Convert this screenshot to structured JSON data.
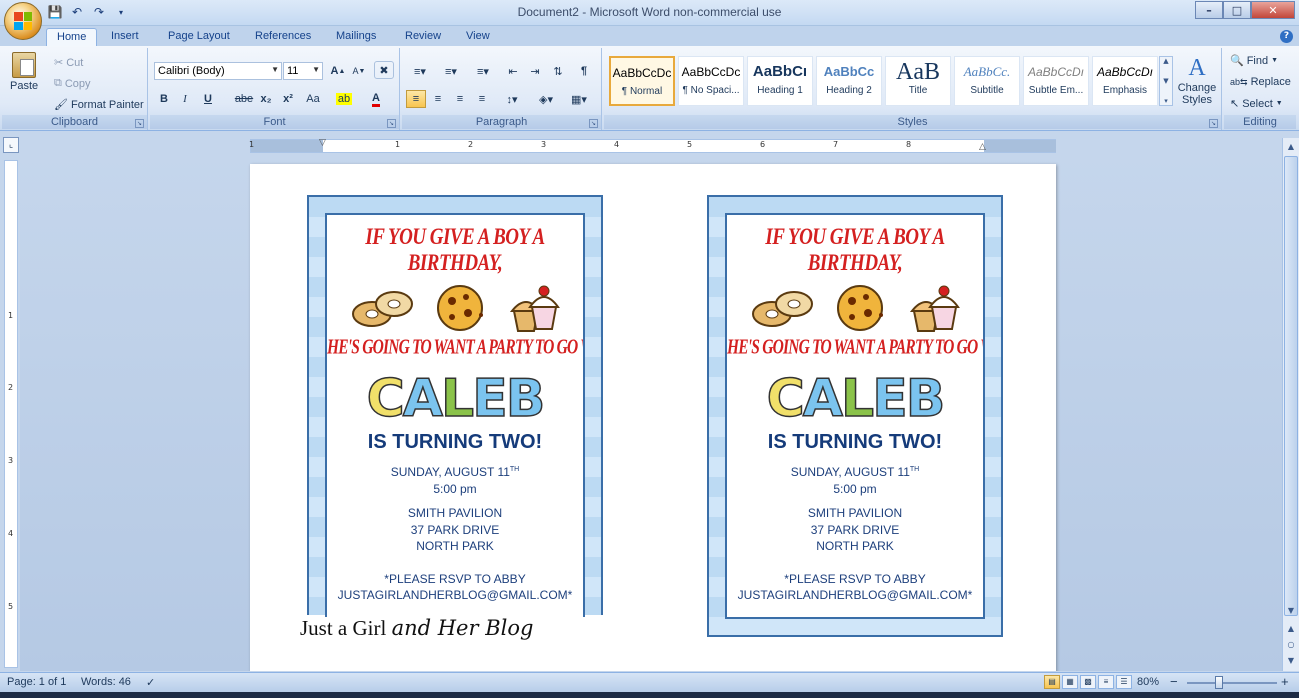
{
  "window": {
    "title": "Document2 - Microsoft Word non-commercial use",
    "controls": {
      "minimize": "–",
      "maximize": "□",
      "close": "✕"
    }
  },
  "quick_access": {
    "save_icon": "save-icon",
    "undo_icon": "undo-icon",
    "redo_icon": "redo-icon"
  },
  "tabs": [
    "Home",
    "Insert",
    "Page Layout",
    "References",
    "Mailings",
    "Review",
    "View"
  ],
  "active_tab": "Home",
  "ribbon": {
    "clipboard": {
      "label": "Clipboard",
      "paste": "Paste",
      "cut": "Cut",
      "copy": "Copy",
      "format_painter": "Format Painter"
    },
    "font": {
      "label": "Font",
      "font_name": "Calibri (Body)",
      "font_size": "11",
      "bold": "B",
      "italic": "I",
      "underline": "U",
      "strike": "abe",
      "subscript": "x₂",
      "superscript": "x²",
      "change_case": "Aa"
    },
    "paragraph": {
      "label": "Paragraph"
    },
    "styles": {
      "label": "Styles",
      "tiles": [
        {
          "sample": "AaBbCcDc",
          "name": "¶ Normal"
        },
        {
          "sample": "AaBbCcDc",
          "name": "¶ No Spaci..."
        },
        {
          "sample": "AaBbCı",
          "name": "Heading 1"
        },
        {
          "sample": "AaBbCc",
          "name": "Heading 2"
        },
        {
          "sample": "AaB",
          "name": "Title"
        },
        {
          "sample": "AaBbCc.",
          "name": "Subtitle"
        },
        {
          "sample": "AaBbCcDı",
          "name": "Subtle Em..."
        },
        {
          "sample": "AaBbCcDı",
          "name": "Emphasis"
        }
      ],
      "change_styles": "Change Styles"
    },
    "editing": {
      "label": "Editing",
      "find": "Find",
      "replace": "Replace",
      "select": "Select"
    }
  },
  "ruler": {
    "numbers": [
      "1",
      "1",
      "2",
      "3",
      "4",
      "5",
      "6",
      "7",
      "8"
    ]
  },
  "vruler": {
    "numbers": [
      "1",
      "2",
      "3",
      "4",
      "5"
    ]
  },
  "invitation": {
    "line1": "IF YOU GIVE A BOY A BIRTHDAY,",
    "line2": "HE'S GOING TO WANT A PARTY TO GO WITH IT...",
    "name_letters": [
      "C",
      "A",
      "L",
      "E",
      "B"
    ],
    "name_colors": [
      "#f1e06a",
      "#7bc4ef",
      "#8bc34a",
      "#7bc4ef",
      "#7bc4ef"
    ],
    "turning": "IS TURNING TWO!",
    "date": "SUNDAY, AUGUST 11",
    "date_sup": "TH",
    "time": "5:00 pm",
    "place": "SMITH PAVILION",
    "street": "37 PARK DRIVE",
    "city": "NORTH PARK",
    "rsvp": "*PLEASE RSVP TO ABBY",
    "email": "JUSTAGIRLANDHERBLOG@GMAIL.COM*"
  },
  "watermark": {
    "plain": "Just a Girl ",
    "script": "and Her Blog"
  },
  "status": {
    "page": "Page: 1 of 1",
    "words": "Words: 46",
    "zoom": "80%",
    "zoom_minus": "−",
    "zoom_plus": "+"
  },
  "colors": {
    "accent": "#15428b",
    "card_border": "#3a6ea8",
    "headline": "#d42020"
  }
}
